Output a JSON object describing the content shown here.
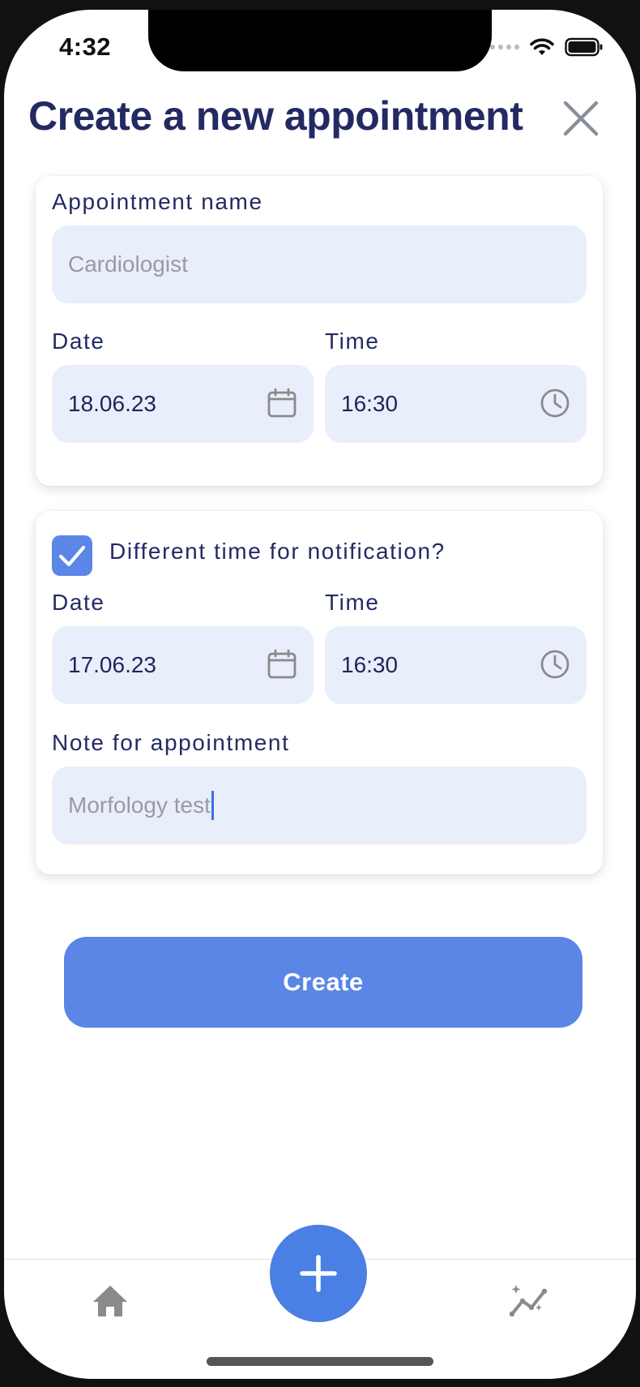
{
  "status_bar": {
    "time": "4:32"
  },
  "header": {
    "title": "Create a new appointment"
  },
  "appointment": {
    "name_label": "Appointment name",
    "name_placeholder": "Cardiologist",
    "date_label": "Date",
    "date_value": "18.06.23",
    "time_label": "Time",
    "time_value": "16:30"
  },
  "notification": {
    "checkbox_label": "Different time for notification?",
    "checked": true,
    "date_label": "Date",
    "date_value": "17.06.23",
    "time_label": "Time",
    "time_value": "16:30",
    "note_label": "Note for appointment",
    "note_value": "Morfology test"
  },
  "actions": {
    "create_label": "Create"
  },
  "tab_bar": {
    "items": [
      {
        "icon": "home-icon"
      },
      {
        "icon": "plus-icon"
      },
      {
        "icon": "chart-line-icon"
      }
    ]
  },
  "colors": {
    "accent": "#5b86e5",
    "title": "#232a63",
    "field_bg": "#e9eefb",
    "fab": "#4a7fe3"
  }
}
